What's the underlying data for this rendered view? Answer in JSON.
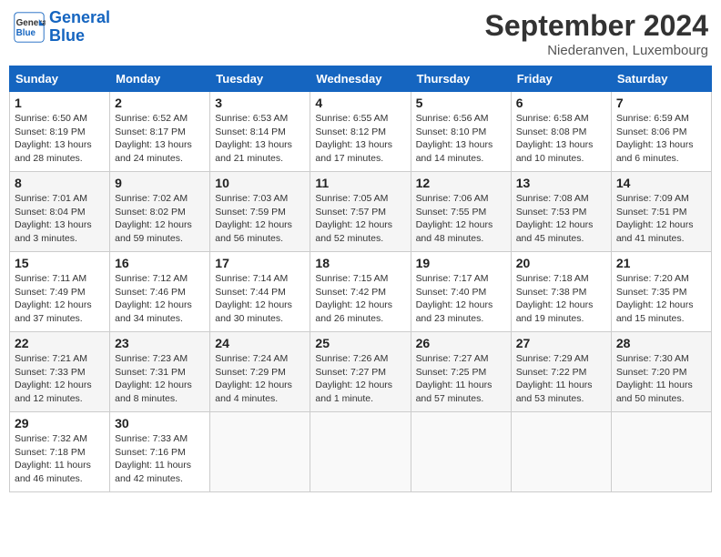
{
  "header": {
    "logo_line1": "General",
    "logo_line2": "Blue",
    "month_year": "September 2024",
    "location": "Niederanven, Luxembourg"
  },
  "weekdays": [
    "Sunday",
    "Monday",
    "Tuesday",
    "Wednesday",
    "Thursday",
    "Friday",
    "Saturday"
  ],
  "weeks": [
    [
      {
        "day": "1",
        "sunrise": "Sunrise: 6:50 AM",
        "sunset": "Sunset: 8:19 PM",
        "daylight": "Daylight: 13 hours and 28 minutes."
      },
      {
        "day": "2",
        "sunrise": "Sunrise: 6:52 AM",
        "sunset": "Sunset: 8:17 PM",
        "daylight": "Daylight: 13 hours and 24 minutes."
      },
      {
        "day": "3",
        "sunrise": "Sunrise: 6:53 AM",
        "sunset": "Sunset: 8:14 PM",
        "daylight": "Daylight: 13 hours and 21 minutes."
      },
      {
        "day": "4",
        "sunrise": "Sunrise: 6:55 AM",
        "sunset": "Sunset: 8:12 PM",
        "daylight": "Daylight: 13 hours and 17 minutes."
      },
      {
        "day": "5",
        "sunrise": "Sunrise: 6:56 AM",
        "sunset": "Sunset: 8:10 PM",
        "daylight": "Daylight: 13 hours and 14 minutes."
      },
      {
        "day": "6",
        "sunrise": "Sunrise: 6:58 AM",
        "sunset": "Sunset: 8:08 PM",
        "daylight": "Daylight: 13 hours and 10 minutes."
      },
      {
        "day": "7",
        "sunrise": "Sunrise: 6:59 AM",
        "sunset": "Sunset: 8:06 PM",
        "daylight": "Daylight: 13 hours and 6 minutes."
      }
    ],
    [
      {
        "day": "8",
        "sunrise": "Sunrise: 7:01 AM",
        "sunset": "Sunset: 8:04 PM",
        "daylight": "Daylight: 13 hours and 3 minutes."
      },
      {
        "day": "9",
        "sunrise": "Sunrise: 7:02 AM",
        "sunset": "Sunset: 8:02 PM",
        "daylight": "Daylight: 12 hours and 59 minutes."
      },
      {
        "day": "10",
        "sunrise": "Sunrise: 7:03 AM",
        "sunset": "Sunset: 7:59 PM",
        "daylight": "Daylight: 12 hours and 56 minutes."
      },
      {
        "day": "11",
        "sunrise": "Sunrise: 7:05 AM",
        "sunset": "Sunset: 7:57 PM",
        "daylight": "Daylight: 12 hours and 52 minutes."
      },
      {
        "day": "12",
        "sunrise": "Sunrise: 7:06 AM",
        "sunset": "Sunset: 7:55 PM",
        "daylight": "Daylight: 12 hours and 48 minutes."
      },
      {
        "day": "13",
        "sunrise": "Sunrise: 7:08 AM",
        "sunset": "Sunset: 7:53 PM",
        "daylight": "Daylight: 12 hours and 45 minutes."
      },
      {
        "day": "14",
        "sunrise": "Sunrise: 7:09 AM",
        "sunset": "Sunset: 7:51 PM",
        "daylight": "Daylight: 12 hours and 41 minutes."
      }
    ],
    [
      {
        "day": "15",
        "sunrise": "Sunrise: 7:11 AM",
        "sunset": "Sunset: 7:49 PM",
        "daylight": "Daylight: 12 hours and 37 minutes."
      },
      {
        "day": "16",
        "sunrise": "Sunrise: 7:12 AM",
        "sunset": "Sunset: 7:46 PM",
        "daylight": "Daylight: 12 hours and 34 minutes."
      },
      {
        "day": "17",
        "sunrise": "Sunrise: 7:14 AM",
        "sunset": "Sunset: 7:44 PM",
        "daylight": "Daylight: 12 hours and 30 minutes."
      },
      {
        "day": "18",
        "sunrise": "Sunrise: 7:15 AM",
        "sunset": "Sunset: 7:42 PM",
        "daylight": "Daylight: 12 hours and 26 minutes."
      },
      {
        "day": "19",
        "sunrise": "Sunrise: 7:17 AM",
        "sunset": "Sunset: 7:40 PM",
        "daylight": "Daylight: 12 hours and 23 minutes."
      },
      {
        "day": "20",
        "sunrise": "Sunrise: 7:18 AM",
        "sunset": "Sunset: 7:38 PM",
        "daylight": "Daylight: 12 hours and 19 minutes."
      },
      {
        "day": "21",
        "sunrise": "Sunrise: 7:20 AM",
        "sunset": "Sunset: 7:35 PM",
        "daylight": "Daylight: 12 hours and 15 minutes."
      }
    ],
    [
      {
        "day": "22",
        "sunrise": "Sunrise: 7:21 AM",
        "sunset": "Sunset: 7:33 PM",
        "daylight": "Daylight: 12 hours and 12 minutes."
      },
      {
        "day": "23",
        "sunrise": "Sunrise: 7:23 AM",
        "sunset": "Sunset: 7:31 PM",
        "daylight": "Daylight: 12 hours and 8 minutes."
      },
      {
        "day": "24",
        "sunrise": "Sunrise: 7:24 AM",
        "sunset": "Sunset: 7:29 PM",
        "daylight": "Daylight: 12 hours and 4 minutes."
      },
      {
        "day": "25",
        "sunrise": "Sunrise: 7:26 AM",
        "sunset": "Sunset: 7:27 PM",
        "daylight": "Daylight: 12 hours and 1 minute."
      },
      {
        "day": "26",
        "sunrise": "Sunrise: 7:27 AM",
        "sunset": "Sunset: 7:25 PM",
        "daylight": "Daylight: 11 hours and 57 minutes."
      },
      {
        "day": "27",
        "sunrise": "Sunrise: 7:29 AM",
        "sunset": "Sunset: 7:22 PM",
        "daylight": "Daylight: 11 hours and 53 minutes."
      },
      {
        "day": "28",
        "sunrise": "Sunrise: 7:30 AM",
        "sunset": "Sunset: 7:20 PM",
        "daylight": "Daylight: 11 hours and 50 minutes."
      }
    ],
    [
      {
        "day": "29",
        "sunrise": "Sunrise: 7:32 AM",
        "sunset": "Sunset: 7:18 PM",
        "daylight": "Daylight: 11 hours and 46 minutes."
      },
      {
        "day": "30",
        "sunrise": "Sunrise: 7:33 AM",
        "sunset": "Sunset: 7:16 PM",
        "daylight": "Daylight: 11 hours and 42 minutes."
      },
      null,
      null,
      null,
      null,
      null
    ]
  ]
}
